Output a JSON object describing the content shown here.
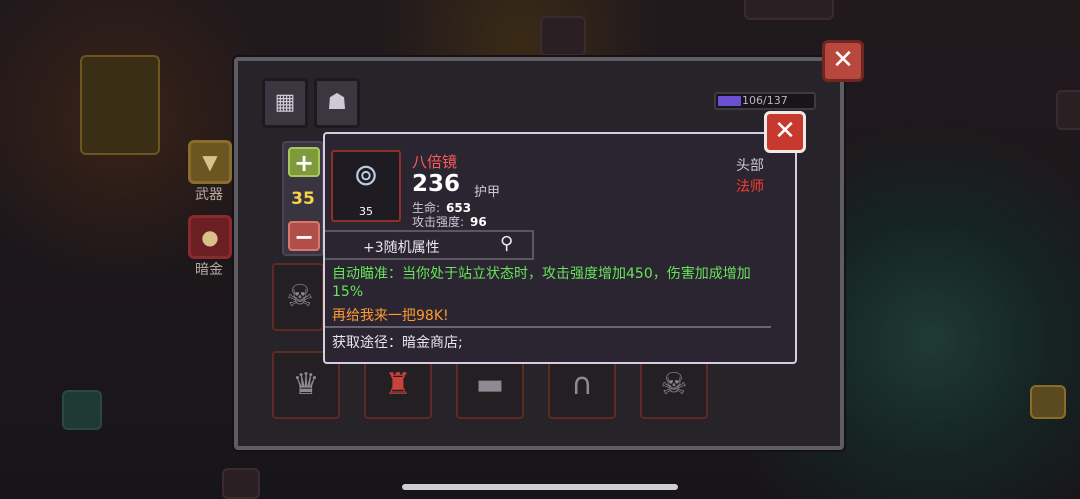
{
  "sidebar": {
    "weapon_label": "武器",
    "darkgold_label": "暗金"
  },
  "inventory": {
    "capacity_text": "106/137",
    "capacity_fraction": 0.774
  },
  "stepper": {
    "plus": "+",
    "minus": "−",
    "value": "35"
  },
  "tooltip": {
    "close": "✕",
    "item_name": "八倍镜",
    "item_level": "35",
    "main_value": "236",
    "main_value_type": "护甲",
    "stats": [
      {
        "label": "生命:",
        "value": "653"
      },
      {
        "label": "攻击强度:",
        "value": "96"
      }
    ],
    "slot_type": "头部",
    "class_type": "法师",
    "random_attr": "+3随机属性",
    "skill_desc": "自动瞄准：当你处于站立状态时，攻击强度增加450，伤害加成增加15%",
    "quote": "再给我来一把98K!",
    "source": "获取途径：暗金商店;"
  },
  "outer_close": "✕",
  "colors": {
    "item_name": "#ff5b5b",
    "class_type": "#ff3b30",
    "skill": "#67e35a",
    "quote": "#ff9a33",
    "step_value": "#f3d44c"
  },
  "icons": {
    "item": "scope-helmet-icon",
    "magnifier": "magnifier-icon",
    "tab1": "grid-icon",
    "tab2": "armor-icon"
  }
}
